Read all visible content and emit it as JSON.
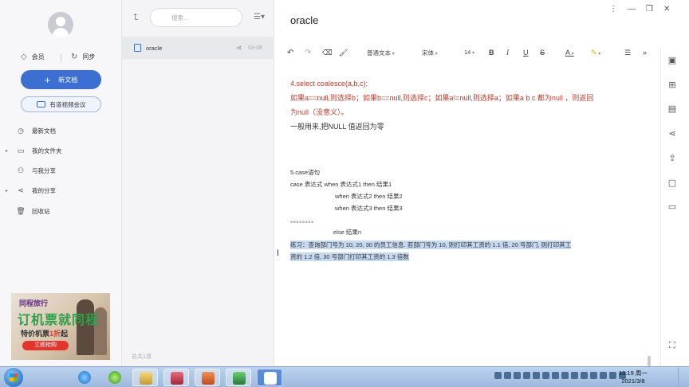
{
  "sidebar": {
    "member_label": "会员",
    "sync_label": "同步",
    "new_doc_label": "新文档",
    "meeting_label": "有道视频会议",
    "nav": [
      {
        "label": "最新文档",
        "icon": "clock-icon",
        "expandable": false
      },
      {
        "label": "我的文件夹",
        "icon": "folder-icon",
        "expandable": true
      },
      {
        "label": "与我分享",
        "icon": "person-share-icon",
        "expandable": false
      },
      {
        "label": "我的分享",
        "icon": "share-icon",
        "expandable": true
      },
      {
        "label": "回收站",
        "icon": "trash-icon",
        "expandable": false
      }
    ],
    "ad": {
      "brand": "同程旅行",
      "headline": "订机票就同程",
      "sub_prefix": "特价机票",
      "sub_highlight": "1折",
      "sub_suffix": "起",
      "cta": "立即抢购"
    }
  },
  "filelist": {
    "search_placeholder": "搜索...",
    "items": [
      {
        "name": "oracle",
        "date": "03-08"
      }
    ],
    "count_text": "总共1项"
  },
  "editor": {
    "title": "oracle",
    "toolbar": {
      "style": "普通文本",
      "font": "宋体",
      "size": "14",
      "bold": "B",
      "italic": "I",
      "underline": "U",
      "strike": "S",
      "font_color": "A"
    },
    "lines": {
      "l1": "4.select coalesce(a,b,c);",
      "l2": "如果a==null,则选择b；如果b==null,则选择c；如果a!=null,则选择a；如果a b c 都为null ，则返回",
      "l3": "为null（没意义）。",
      "l4": "一般用来,把NULL 值返回为零",
      "l5": "5.case语句",
      "l6": "case  表达式  when 表达式1 then  结果1",
      "l7": "when 表达式2 then  结果2",
      "l8": "when 表达式3 then  结果3",
      "l9": "。。。。。。。。",
      "l10": "else  结果n",
      "l11": "练习：查询部门号为  10, 20, 30 的员工信息. 若部门号为  10, 则打印其工资的  1.1 倍, 20 号部门, 则打印其工",
      "l12": "资的  1.2 倍, 30 号部门打印其工资的  1.3 倍数"
    }
  },
  "taskbar": {
    "clock_time": "10:19 周一",
    "clock_date": "2021/3/8"
  },
  "colors": {
    "accent": "#3b6fd1",
    "red_text": "#c0392b",
    "selection": "#c6d9f2"
  }
}
